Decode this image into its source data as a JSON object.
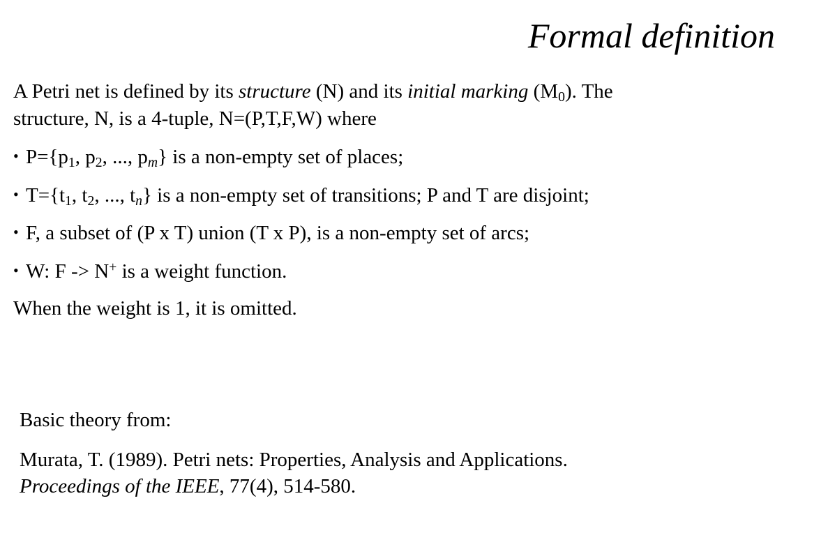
{
  "title": "Formal definition",
  "intro": {
    "t1": "A Petri net is defined by its ",
    "structure_term": "structure",
    "t2": " (N) and its ",
    "marking_term": "initial marking",
    "t3": " (M",
    "marking_sub": "0",
    "t4": "). The",
    "line2": "structure, N, is a 4-tuple, N=(P,T,F,W) where"
  },
  "bullet_glyph": "•",
  "bullets": {
    "places": {
      "a": "P={p",
      "s1": "1",
      "b": ", p",
      "s2": "2",
      "c": ", ..., p",
      "s3": "m",
      "d": "} is a non-empty set of places;"
    },
    "transitions": {
      "a": "T={t",
      "s1": "1",
      "b": ", t",
      "s2": "2",
      "c": ", ..., t",
      "s3": "n",
      "d": "} is a non-empty set of transitions; P and T are disjoint;"
    },
    "arcs": {
      "text": "F,  a subset of (P x T) union (T x P), is a non-empty set of arcs;"
    },
    "weight": {
      "a": "W: F -> N",
      "sup": "+",
      "b": " is a weight function."
    }
  },
  "closing": "When the weight is 1, it is omitted.",
  "reference": {
    "heading": "Basic theory from:",
    "line1": "Murata, T. (1989). Petri nets: Properties, Analysis and Applications.",
    "journal": "Proceedings of the IEEE",
    "rest": ", 77(4), 514-580."
  }
}
